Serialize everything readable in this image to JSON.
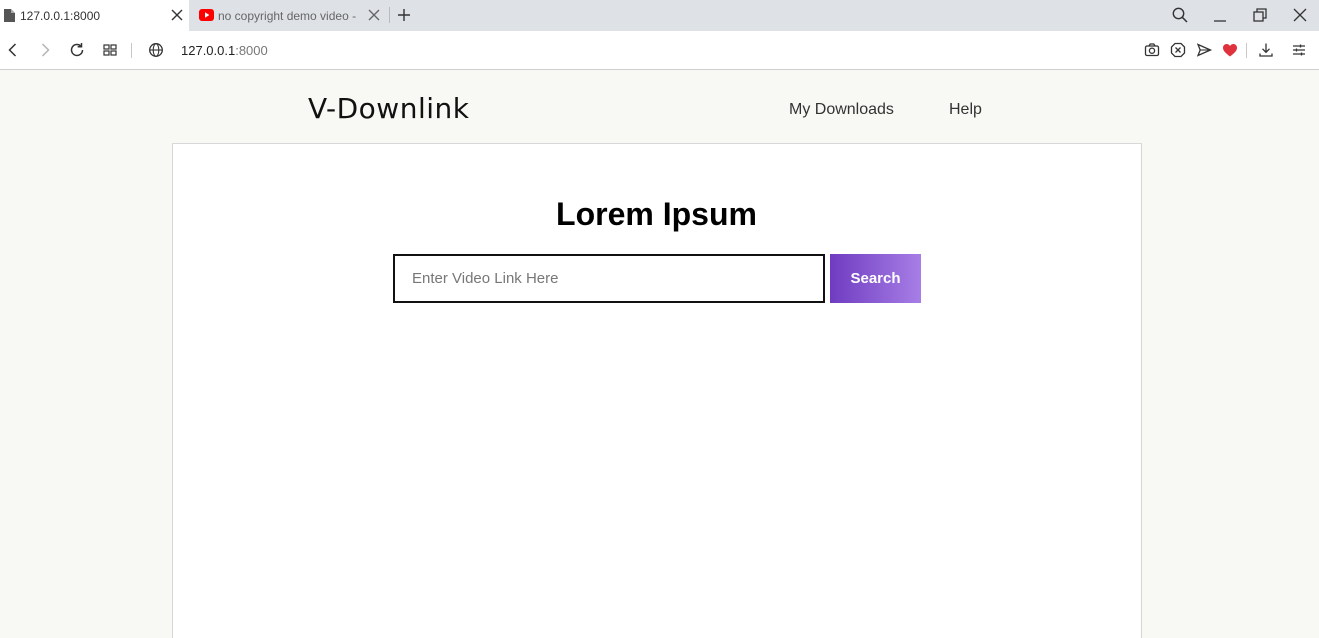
{
  "browser": {
    "tabs": [
      {
        "title": "127.0.0.1:8000",
        "active": true,
        "favicon": "document-icon"
      },
      {
        "title": "no copyright demo video -",
        "active": false,
        "favicon": "youtube-icon"
      }
    ],
    "url_host": "127.0.0.1",
    "url_port": ":8000",
    "colors": {
      "youtube_red": "#ff0000",
      "heart_red": "#e0323c"
    }
  },
  "site": {
    "logo": "V-Downlink",
    "nav": [
      {
        "label": "My Downloads"
      },
      {
        "label": "Help"
      }
    ]
  },
  "hero": {
    "title": "Lorem Ipsum",
    "search": {
      "placeholder": "Enter Video Link Here",
      "value": "",
      "button_label": "Search"
    }
  },
  "theme": {
    "accent_start": "#6f3cc1",
    "accent_end": "#a77ee6",
    "page_bg": "#f8f8f4",
    "card_bg": "#ffffff"
  }
}
